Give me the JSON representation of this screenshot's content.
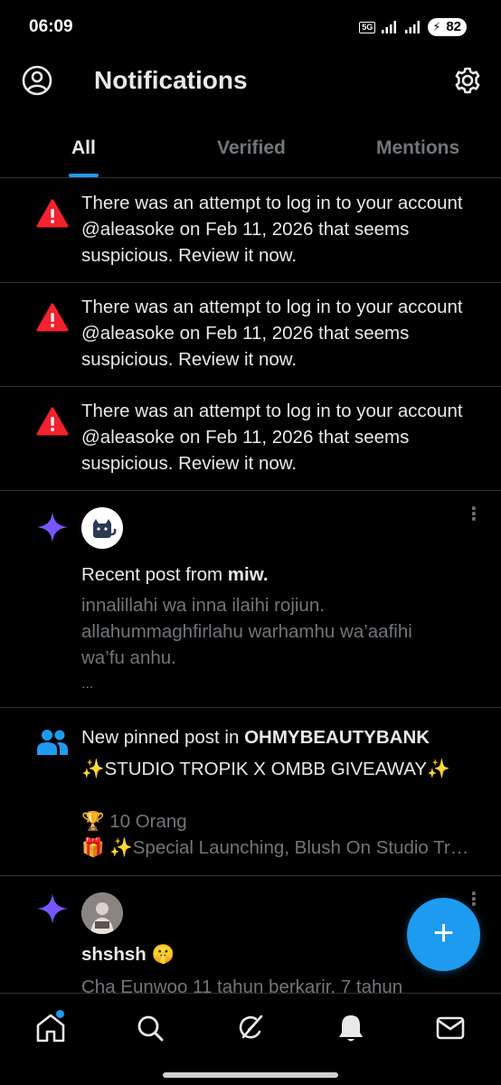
{
  "status_bar": {
    "time": "06:09",
    "network": "5G",
    "battery": "82"
  },
  "header": {
    "title": "Notifications"
  },
  "tabs": [
    {
      "label": "All",
      "active": true
    },
    {
      "label": "Verified",
      "active": false
    },
    {
      "label": "Mentions",
      "active": false
    }
  ],
  "alerts": [
    {
      "text": "There was an attempt to log in to your account @aleasoke on Feb 11, 2026 that seems suspicious. Review it now.",
      "icon": "warning-icon"
    },
    {
      "text": "There was an attempt to log in to your account @aleasoke on Feb 11, 2026 that seems suspicious. Review it now.",
      "icon": "warning-icon"
    },
    {
      "text": "There was an attempt to log in to your account @aleasoke on Feb 11, 2026 that seems suspicious. Review it now.",
      "icon": "warning-icon"
    }
  ],
  "recent_post": {
    "prefix": "Recent post from ",
    "author": "miw.",
    "lines": [
      "innalillahi wa inna ilaihi rojiun.",
      "allahummaghfirlahu warhamhu wa’aafihi",
      "wa’fu anhu.",
      "..."
    ]
  },
  "pinned_post": {
    "prefix": "New pinned post in ",
    "community": "OHMYBEAUTYBANK",
    "lines": [
      "✨STUDIO TROPIK X OMBB GIVEAWAY✨",
      "",
      "🏆 10 Orang",
      "🎁 ✨Special Launching, Blush On Studio Tropik"
    ]
  },
  "last_post": {
    "author": "shshsh 🤫",
    "preview": "Cha Eunwoo 11 tahun berkarir, 7 tahun"
  },
  "fab": {
    "label": "+"
  },
  "colors": {
    "accent": "#1d9bf0",
    "warning": "#f4212e",
    "sparkle": "#7856ff",
    "muted": "#71767b",
    "divider": "#2f3336"
  }
}
